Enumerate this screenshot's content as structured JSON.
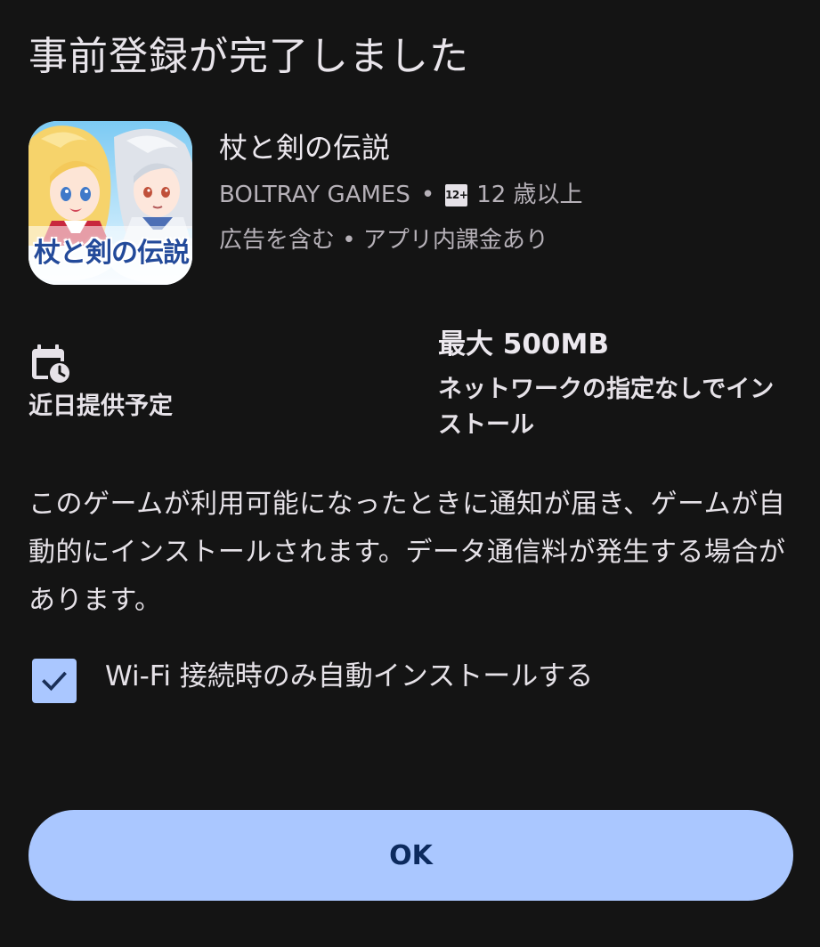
{
  "dialog": {
    "title": "事前登録が完了しました"
  },
  "app": {
    "name": "杖と剣の伝説",
    "developer": "BOLTRAY GAMES",
    "separator": "•",
    "age_badge": "12+",
    "age_rating": "12 歳以上",
    "monetization": "広告を含む • アプリ内課金あり",
    "icon_logo_text": "杖と剣の伝説",
    "icon_name": "app-icon"
  },
  "release": {
    "icon": "calendar-clock-icon",
    "label": "近日提供予定"
  },
  "download": {
    "size": "最大 500MB",
    "network_note": "ネットワークの指定なしでインストール"
  },
  "description": "このゲームが利用可能になったときに通知が届き、ゲームが自動的にインストールされます。データ通信料が発生する場合があります。",
  "wifi_option": {
    "label": "Wi-Fi 接続時のみ自動インストールする",
    "checked": true
  },
  "ok_button": {
    "label": "OK"
  },
  "colors": {
    "background": "#141414",
    "accent": "#aac7ff",
    "accent_text": "#0c2a5e",
    "primary_text": "#e6e2e8",
    "secondary_text": "#b6b1b8"
  }
}
